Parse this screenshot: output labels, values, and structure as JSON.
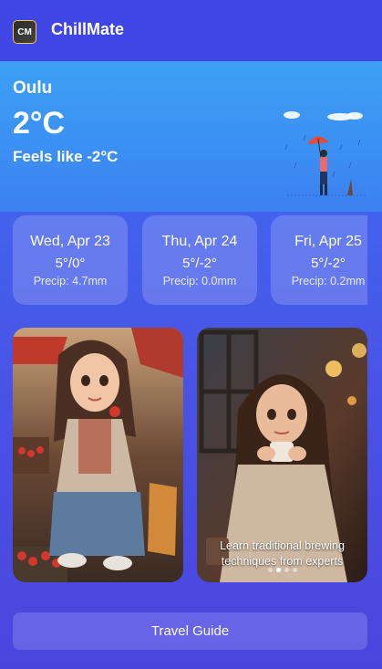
{
  "app": {
    "title": "ChillMate",
    "logo_text": "CM"
  },
  "weather": {
    "city": "Oulu",
    "temperature": "2°C",
    "feels_like": "Feels like -2°C",
    "illustration": "person-with-umbrella-in-rain"
  },
  "forecast": [
    {
      "date": "Wed, Apr 23",
      "temps": "5°/0°",
      "precip": "Precip: 4.7mm"
    },
    {
      "date": "Thu, Apr 24",
      "temps": "5°/-2°",
      "precip": "Precip: 0.0mm"
    },
    {
      "date": "Fri, Apr 25",
      "temps": "5°/-2°",
      "precip": "Precip: 0.2mm"
    }
  ],
  "gallery": {
    "items": [
      {
        "image": "girl-sitting-with-strawberries-at-market"
      },
      {
        "image": "girl-holding-tea-cup-in-cafe",
        "caption": "Learn traditional brewing techniques from experts"
      }
    ],
    "pager": {
      "count": 4,
      "active": 1
    }
  },
  "actions": {
    "travel_guide_label": "Travel Guide"
  },
  "colors": {
    "header": "#3f46e3",
    "weather_bg": "#3ca0f5",
    "page_bg": "#4a52e6"
  }
}
